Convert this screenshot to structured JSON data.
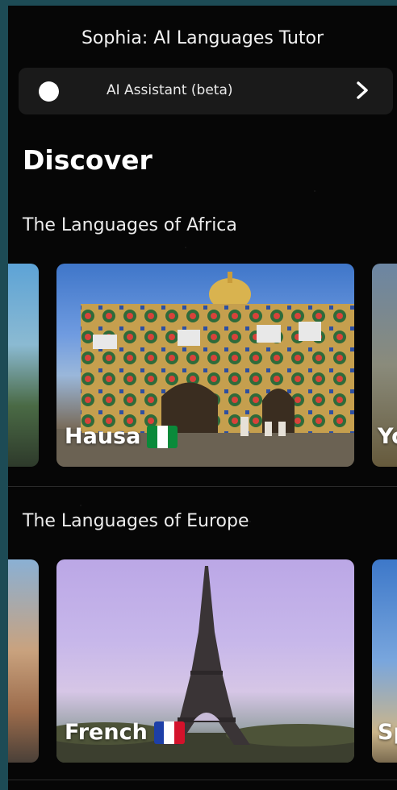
{
  "header": {
    "title": "Sophia: AI Languages Tutor"
  },
  "assistant": {
    "label": "AI Assistant (beta)",
    "icon": "white-circle",
    "chevron": "chevron-right-icon"
  },
  "discover": {
    "title": "Discover"
  },
  "sections": [
    {
      "title": "The Languages of Africa",
      "cards": [
        {
          "label": "",
          "visibility": "partial-left"
        },
        {
          "label": "Hausa",
          "flag": "nigeria",
          "flag_colors": [
            "#0a8a3a",
            "#ffffff",
            "#0a8a3a"
          ]
        },
        {
          "label": "Yo",
          "visibility": "partial-right"
        }
      ]
    },
    {
      "title": "The Languages of Europe",
      "cards": [
        {
          "label": "",
          "visibility": "partial-left"
        },
        {
          "label": "French",
          "flag": "france",
          "flag_colors": [
            "#1d3fa8",
            "#ffffff",
            "#d3122b"
          ]
        },
        {
          "label": "Sp",
          "visibility": "partial-right"
        }
      ]
    }
  ],
  "colors": {
    "frame": "#1d4b55",
    "background": "#060606",
    "bar": "#1a1a1a"
  }
}
